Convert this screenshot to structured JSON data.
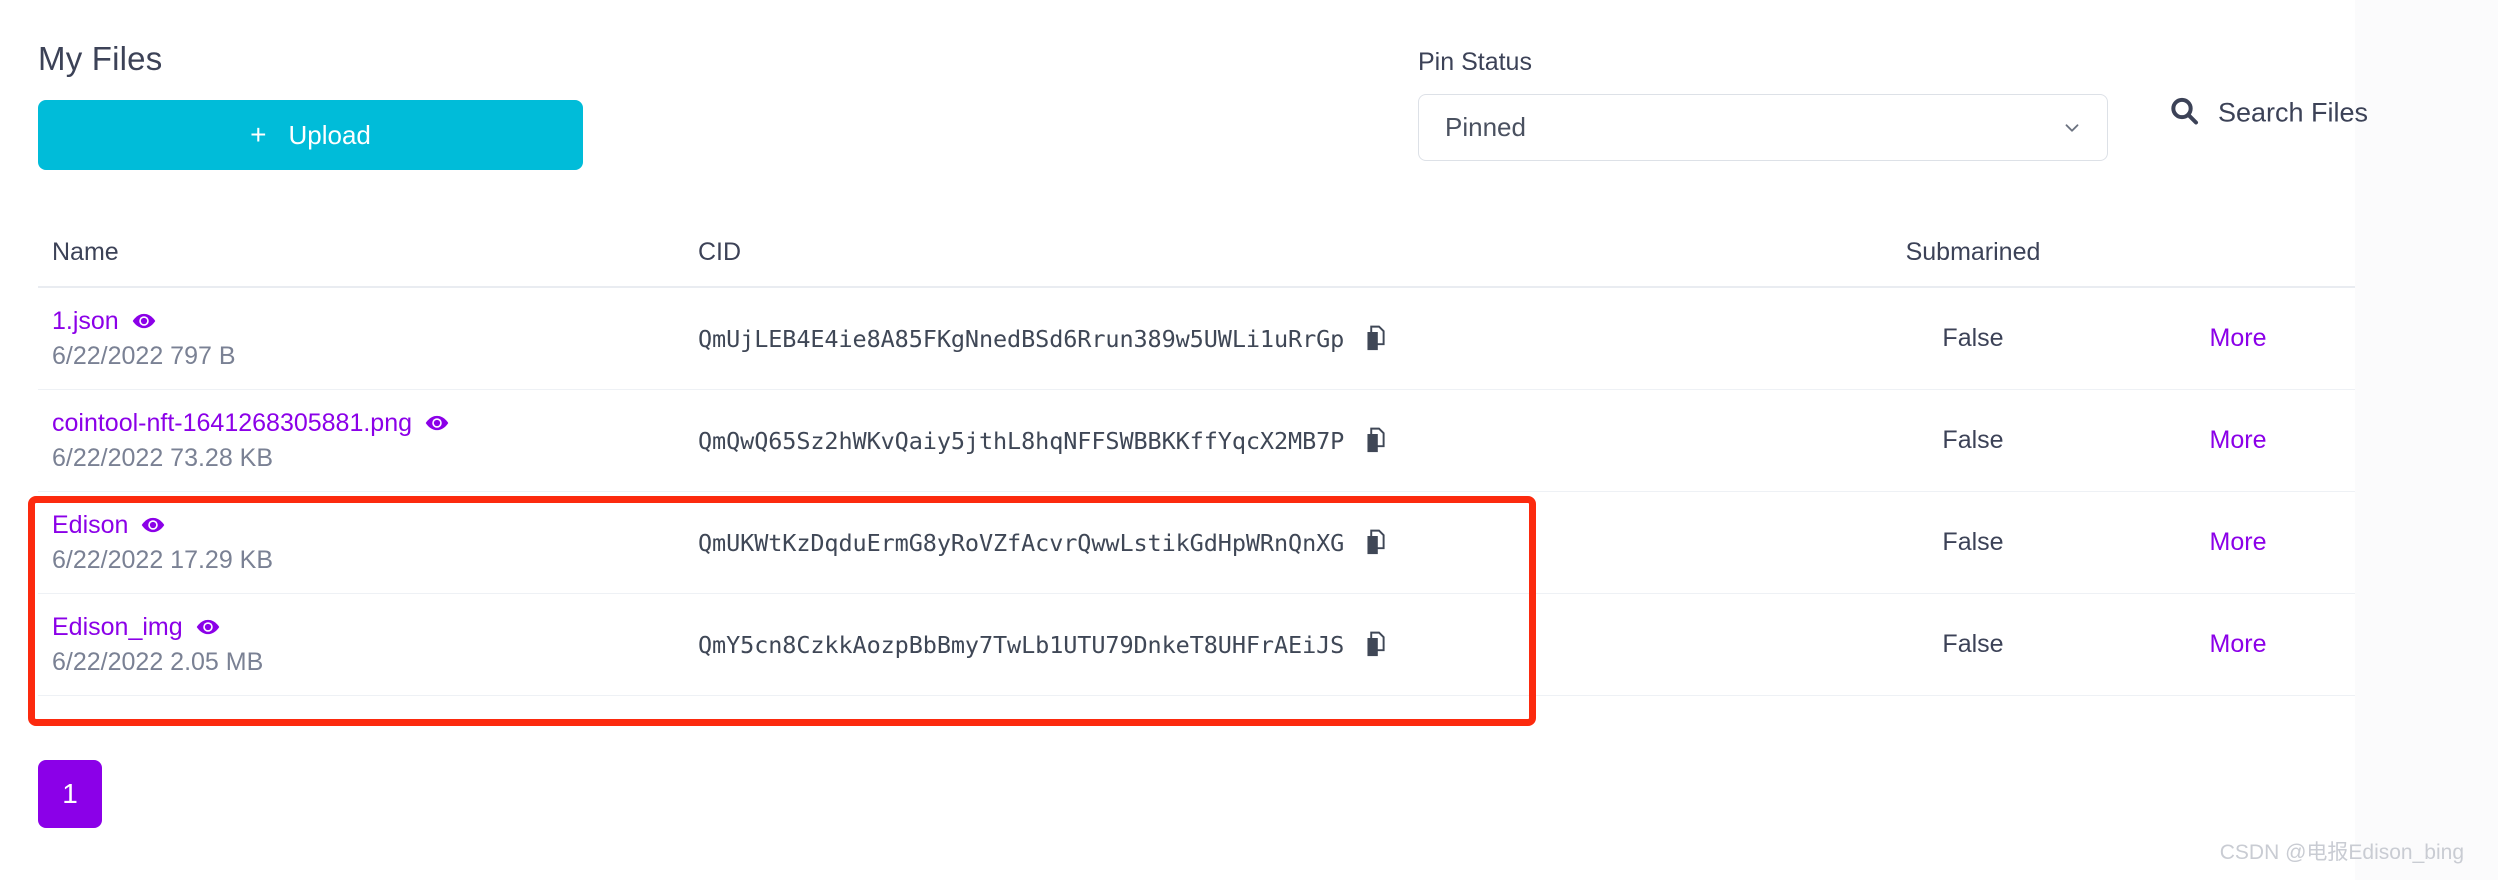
{
  "header": {
    "title": "My Files",
    "upload_button": {
      "label": "Upload",
      "plus_glyph": "+",
      "color": "#00bcd9"
    },
    "pin_status": {
      "label": "Pin Status",
      "selected": "Pinned",
      "options": [
        "Pinned"
      ],
      "chevron_icon": "chevron-down-icon"
    },
    "search": {
      "label": "Search Files",
      "icon": "search-icon"
    }
  },
  "table": {
    "columns": [
      "Name",
      "CID",
      "Submarined",
      ""
    ],
    "rows": [
      {
        "name": "1.json",
        "meta": "6/22/2022 797 B",
        "cid": "QmUjLEB4E4ie8A85FKgNnedBSd6Rrun389w5UWLi1uRrGp",
        "submarined": "False",
        "more": "More",
        "eye_icon": "eye-icon",
        "copy_icon": "copy-icon"
      },
      {
        "name": "cointool-nft-1641268305881.png",
        "meta": "6/22/2022 73.28 KB",
        "cid": "QmQwQ65Sz2hWKvQaiy5jthL8hqNFFSWBBKKffYqcX2MB7P",
        "submarined": "False",
        "more": "More",
        "eye_icon": "eye-icon",
        "copy_icon": "copy-icon"
      },
      {
        "name": "Edison",
        "meta": "6/22/2022 17.29 KB",
        "cid": "QmUKWtKzDqduErmG8yRoVZfAcvrQwwLstikGdHpWRnQnXG",
        "submarined": "False",
        "more": "More",
        "eye_icon": "eye-icon",
        "copy_icon": "copy-icon"
      },
      {
        "name": "Edison_img",
        "meta": "6/22/2022 2.05 MB",
        "cid": "QmY5cn8CzkkAozpBbBmy7TwLb1UTU79DnkeT8UHFrAEiJS",
        "submarined": "False",
        "more": "More",
        "eye_icon": "eye-icon",
        "copy_icon": "copy-icon"
      }
    ]
  },
  "pagination": {
    "pages": [
      "1"
    ],
    "current": "1",
    "color": "#8b00e8"
  },
  "annotation": {
    "color": "#fc2a0e",
    "covers_rows": [
      "Edison",
      "Edison_img"
    ]
  },
  "watermark": {
    "text": "CSDN @电报Edison_bing"
  },
  "colors": {
    "link": "#8b00e8",
    "accent": "#00bcd9",
    "text": "#3c4257",
    "muted": "#7a8194"
  }
}
